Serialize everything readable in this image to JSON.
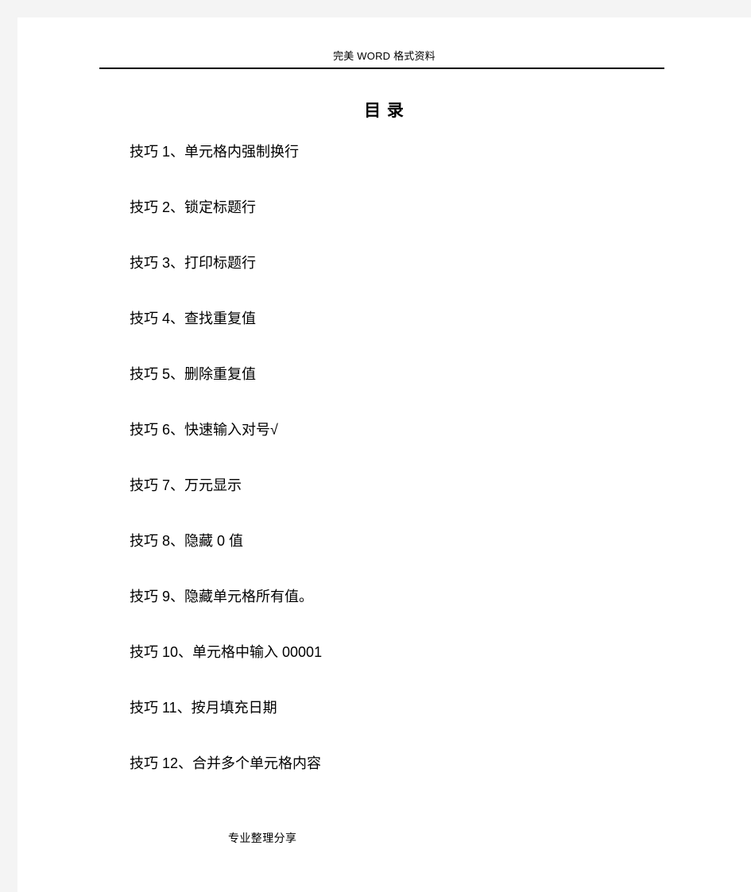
{
  "header": {
    "text": "完美 WORD 格式资料"
  },
  "title": "目 录",
  "toc": {
    "items": [
      {
        "label": "技巧 1、单元格内强制换行"
      },
      {
        "label": "技巧 2、锁定标题行"
      },
      {
        "label": "技巧 3、打印标题行"
      },
      {
        "label": "技巧 4、查找重复值"
      },
      {
        "label": "技巧 5、删除重复值"
      },
      {
        "label": "技巧 6、快速输入对号√"
      },
      {
        "label": "技巧 7、万元显示"
      },
      {
        "label": "技巧 8、隐藏 0 值"
      },
      {
        "label": "技巧 9、隐藏单元格所有值。"
      },
      {
        "label": "技巧 10、单元格中输入 00001"
      },
      {
        "label": "技巧 11、按月填充日期"
      },
      {
        "label": "技巧 12、合并多个单元格内容"
      }
    ]
  },
  "footer": {
    "text": "专业整理分享"
  },
  "colors": {
    "page_background": "#f4f4f4",
    "sheet": "#ffffff",
    "text": "#000000",
    "rule": "#000000"
  }
}
